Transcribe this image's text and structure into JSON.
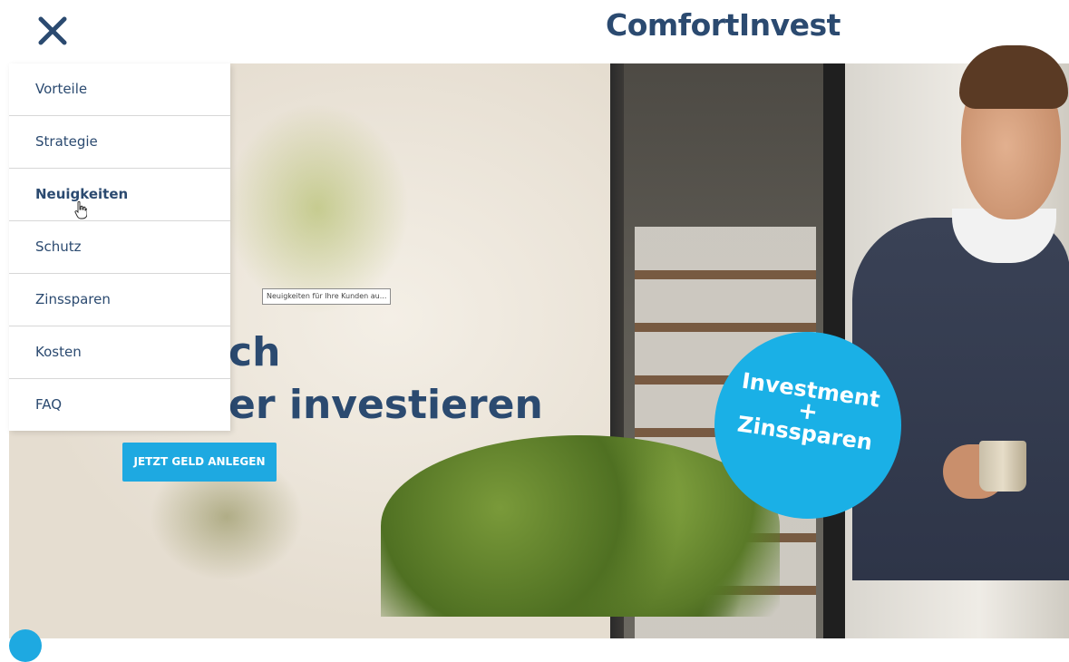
{
  "header": {
    "logo_text": "ComfortInvest",
    "close_icon": "close-icon"
  },
  "nav": {
    "items": [
      {
        "label": "Vorteile"
      },
      {
        "label": "Strategie"
      },
      {
        "label": "Neuigkeiten",
        "active": true
      },
      {
        "label": "Schutz"
      },
      {
        "label": "Zinssparen"
      },
      {
        "label": "Kosten"
      },
      {
        "label": "FAQ"
      }
    ]
  },
  "tooltip": {
    "text": "Neuigkeiten für Ihre Kunden au..."
  },
  "hero": {
    "headline_line1": "ch",
    "headline_line2": "er investieren",
    "cta_label": "JETZT GELD ANLEGEN",
    "badge_line1": "Investment",
    "badge_plus": "+",
    "badge_line2": "Zinssparen"
  },
  "colors": {
    "brand_navy": "#2b4a70",
    "accent_blue": "#1ea9e1"
  }
}
